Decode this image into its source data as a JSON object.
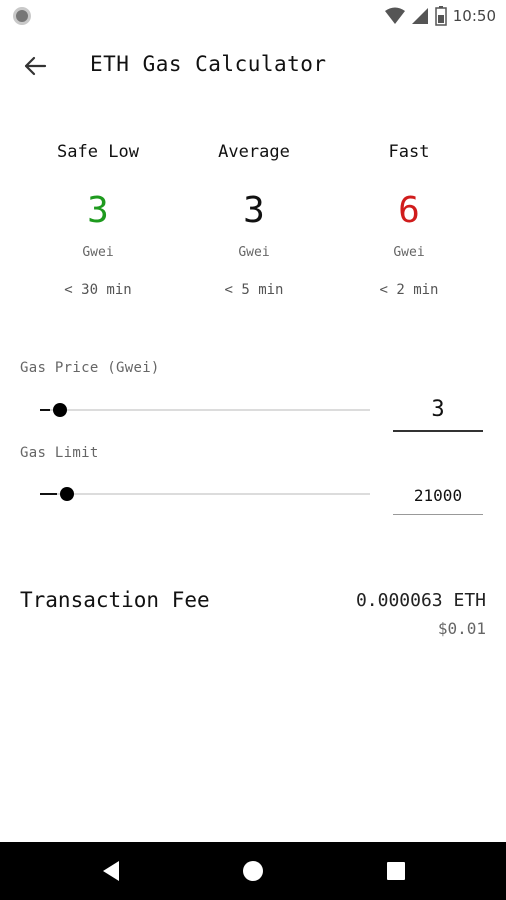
{
  "status_bar": {
    "time": "10:50",
    "icons": [
      "wifi-icon",
      "signal-icon",
      "battery-icon"
    ]
  },
  "app_bar": {
    "title": "ETH Gas Calculator",
    "back_icon": "arrow-left-icon"
  },
  "gas_tiers": [
    {
      "label": "Safe Low",
      "value": "3",
      "unit": "Gwei",
      "time": "< 30 min",
      "color": "#1e9a1e"
    },
    {
      "label": "Average",
      "value": "3",
      "unit": "Gwei",
      "time": "< 5 min",
      "color": "#111111"
    },
    {
      "label": "Fast",
      "value": "6",
      "unit": "Gwei",
      "time": "< 2 min",
      "color": "#d01c1c"
    }
  ],
  "gas_price": {
    "label": "Gas Price (Gwei)",
    "value": "3",
    "slider_fraction": 0.03
  },
  "gas_limit": {
    "label": "Gas Limit",
    "value": "21000",
    "slider_fraction": 0.05
  },
  "fee": {
    "label": "Transaction Fee",
    "eth": "0.000063 ETH",
    "usd": "$0.01"
  },
  "nav_bar": {
    "icons": [
      "back-triangle-icon",
      "home-circle-icon",
      "recents-square-icon"
    ]
  }
}
